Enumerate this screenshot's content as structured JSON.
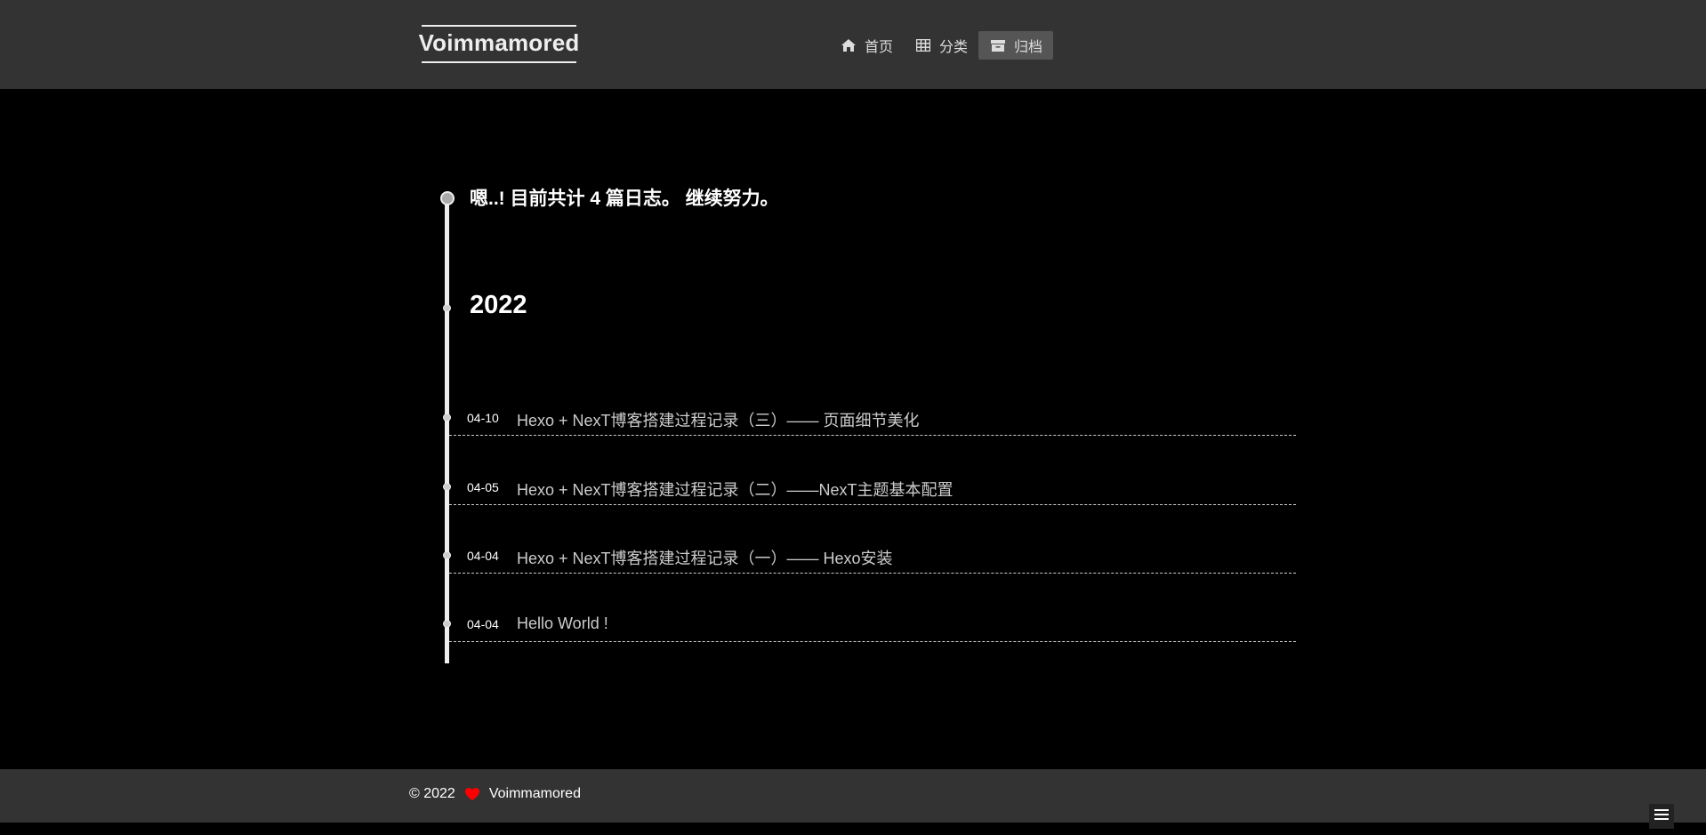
{
  "header": {
    "brand": "Voimmamored",
    "nav": [
      {
        "label": "首页",
        "icon": "home-icon",
        "active": false
      },
      {
        "label": "分类",
        "icon": "grid-icon",
        "active": false
      },
      {
        "label": "归档",
        "icon": "archive-icon",
        "active": true
      }
    ]
  },
  "archive": {
    "summary": "嗯..! 目前共计 4 篇日志。 继续努力。",
    "year": "2022",
    "posts": [
      {
        "date": "04-10",
        "title": "Hexo + NexT博客搭建过程记录（三）—— 页面细节美化"
      },
      {
        "date": "04-05",
        "title": "Hexo + NexT博客搭建过程记录（二）——NexT主题基本配置"
      },
      {
        "date": "04-04",
        "title": "Hexo + NexT博客搭建过程记录（一）—— Hexo安装"
      },
      {
        "date": "04-04",
        "title": "Hello World !"
      }
    ]
  },
  "footer": {
    "copyright": "© 2022",
    "author": "Voimmamored",
    "heart_color": "#ff0000"
  },
  "colors": {
    "header_bg": "#333333",
    "body_bg": "#000000",
    "active_nav_bg": "#555555"
  }
}
